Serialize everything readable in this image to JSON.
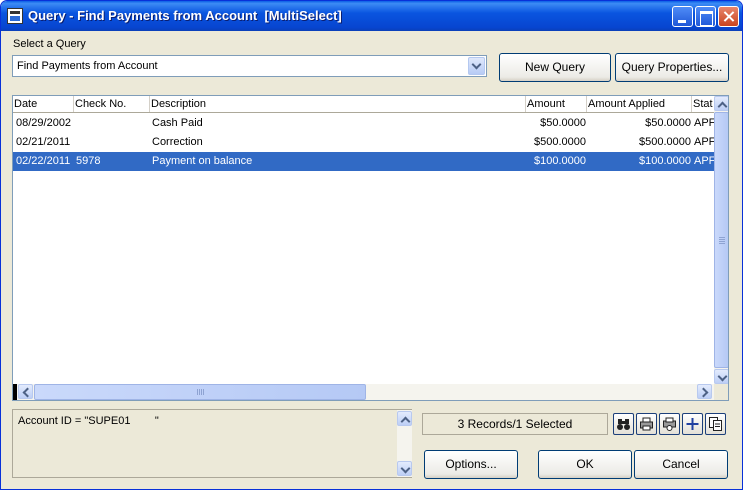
{
  "window": {
    "title": "Query - Find Payments from Account  [MultiSelect]"
  },
  "query": {
    "label": "Select a Query",
    "selected": "Find Payments from Account",
    "new_query_label": "New Query",
    "properties_label": "Query Properties..."
  },
  "grid": {
    "columns": [
      "Date",
      "Check No.",
      "Description",
      "Amount",
      "Amount Applied",
      "Stat"
    ],
    "rows": [
      {
        "date": "08/29/2002",
        "check_no": "",
        "description": "Cash Paid",
        "amount": "$50.0000",
        "amount_applied": "$50.0000",
        "status": "APF"
      },
      {
        "date": "02/21/2011",
        "check_no": "",
        "description": "Correction",
        "amount": "$500.0000",
        "amount_applied": "$500.0000",
        "status": "APF"
      },
      {
        "date": "02/22/2011",
        "check_no": "5978",
        "description": "Payment on balance",
        "amount": "$100.0000",
        "amount_applied": "$100.0000",
        "status": "APF"
      }
    ],
    "selected_row": 2
  },
  "info": {
    "text": "Account ID = \"SUPE01        \""
  },
  "status": {
    "text": "3 Records/1 Selected"
  },
  "toolbar": {
    "icons": [
      "binoculars-icon",
      "printer-icon",
      "print-preview-icon",
      "add-icon",
      "copy-icon"
    ]
  },
  "buttons": {
    "options_label": "Options...",
    "ok_label": "OK",
    "cancel_label": "Cancel"
  },
  "colors": {
    "title_bar": "#0a55e0",
    "selection": "#316ac5",
    "dialog_bg": "#ece9d8"
  }
}
